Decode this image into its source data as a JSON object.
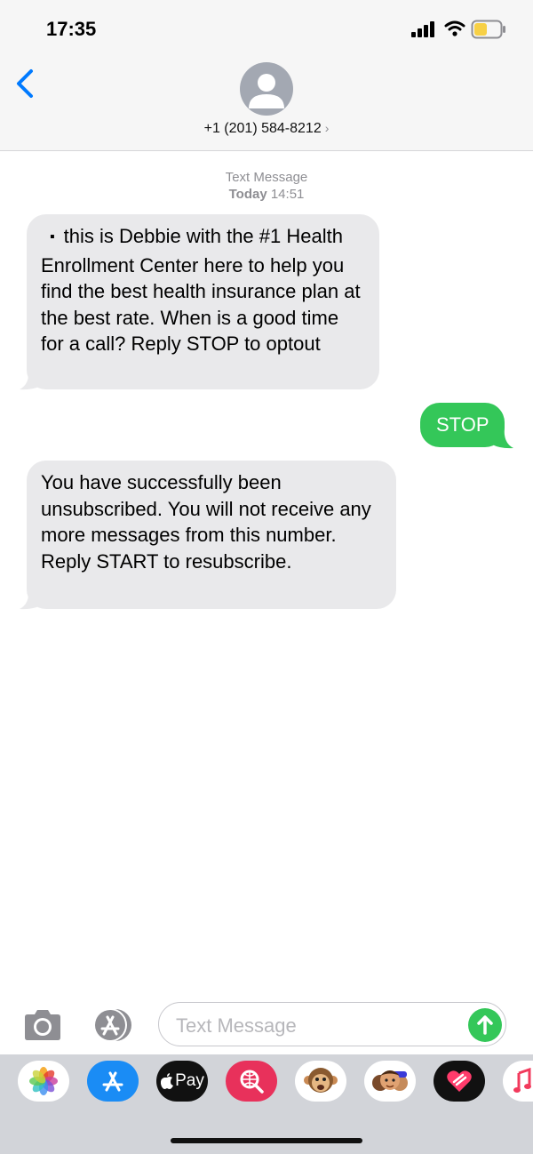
{
  "status_bar": {
    "time": "17:35"
  },
  "header": {
    "contact": "+1 (201) 584-8212",
    "contact_chevron": "›"
  },
  "thread": {
    "service": "Text Message",
    "day": "Today",
    "time": "14:51"
  },
  "messages": [
    {
      "direction": "incoming",
      "bullet": "▪",
      "text": "this is Debbie with the #1 Health Enrollment Center here to help you find the best health insurance plan at the best rate. When is a good time for a call? Reply STOP to optout"
    },
    {
      "direction": "outgoing",
      "text": "STOP"
    },
    {
      "direction": "incoming",
      "text": "You have successfully been unsubscribed. You will not receive any more messages from this number. Reply START to resubscribe."
    }
  ],
  "composer": {
    "placeholder": "Text Message"
  },
  "app_tray": [
    {
      "icon": "photos-icon"
    },
    {
      "icon": "app-store-icon"
    },
    {
      "icon": "apple-pay-icon",
      "label": "Pay"
    },
    {
      "icon": "search-images-icon"
    },
    {
      "icon": "monkey-animoji-icon"
    },
    {
      "icon": "memoji-stickers-icon"
    },
    {
      "icon": "digital-touch-icon"
    },
    {
      "icon": "music-icon"
    }
  ],
  "colors": {
    "incoming_bubble": "#e9e9eb",
    "outgoing_bubble": "#34c759",
    "accent": "#007aff",
    "tray_background": "#d2d4d9"
  }
}
